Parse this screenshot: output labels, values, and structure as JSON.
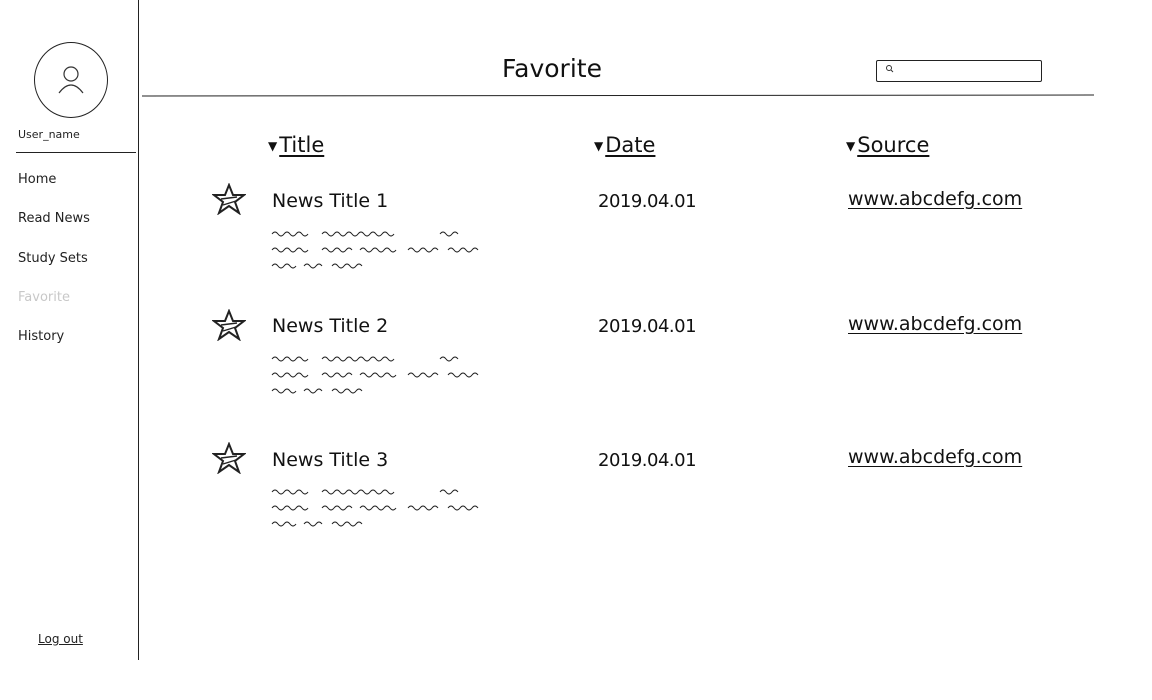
{
  "sidebar": {
    "username": "User_name",
    "nav": [
      {
        "label": "Home",
        "active": false
      },
      {
        "label": "Read News",
        "active": false
      },
      {
        "label": "Study Sets",
        "active": false
      },
      {
        "label": "Favorite",
        "active": true
      },
      {
        "label": "History",
        "active": false
      }
    ],
    "logout_label": "Log out",
    "avatar_icon": "user-avatar-icon"
  },
  "header": {
    "title": "Favorite",
    "search": {
      "value": "",
      "placeholder": "",
      "icon": "search-icon"
    }
  },
  "table": {
    "columns": [
      {
        "label": "Title",
        "icon": "sort-down-icon"
      },
      {
        "label": "Date",
        "icon": "sort-down-icon"
      },
      {
        "label": "Source",
        "icon": "sort-down-icon"
      }
    ],
    "rows": [
      {
        "title": "News Title 1",
        "date": "2019.04.01",
        "source": "www.abcdefg.com",
        "icon": "star-icon"
      },
      {
        "title": "News Title 2",
        "date": "2019.04.01",
        "source": "www.abcdefg.com",
        "icon": "star-icon"
      },
      {
        "title": "News Title 3",
        "date": "2019.04.01",
        "source": "www.abcdefg.com",
        "icon": "star-icon"
      }
    ]
  },
  "colors": {
    "active_nav": "#c8c8c8",
    "ink": "#111111"
  }
}
